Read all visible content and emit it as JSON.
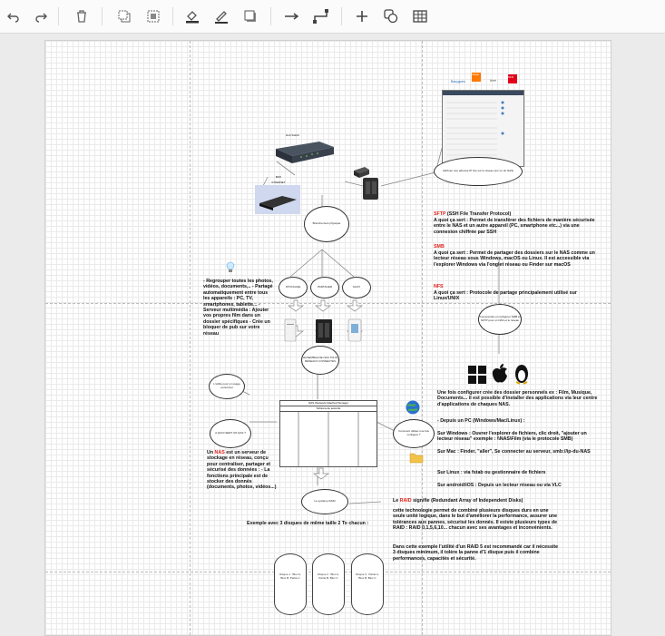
{
  "toolbar": {
    "icons": [
      "undo-icon",
      "redo-icon",
      "delete-icon",
      "to-front-icon",
      "to-back-icon",
      "fill-color-icon",
      "line-color-icon",
      "shadow-icon",
      "connection-icon",
      "waypoints-icon",
      "insert-icon",
      "shape-icon",
      "table-icon"
    ]
  },
  "diagram": {
    "isp_logos": [
      "Bouygues",
      "orange",
      "free",
      "SFR"
    ],
    "switch_label": "Hub Switch",
    "box_label": "BOX INTERNET",
    "ip_ellipse": "Attribuer une adresse IP fixe sur le réseau (sur un du NAS)",
    "montage_ellipse": "Branchement physique",
    "share_ellipses": [
      "STOCKAGE",
      "PARTAGER",
      "SAUV"
    ],
    "nas_ellipse": "ENSEMBLE DE NAS TOUS RESEAUX CONNECTES",
    "os_ellipse": "Comprendre et configurer SMB et SFTP pour un NAS et le réseau",
    "util_ellipse": "L'utilité pour un usage personnel",
    "what_ellipse": "A QUOI SERT UN NAS ?",
    "access_ellipse": "Comment utiliser une fois configuré ?",
    "raid_ellipse": "Le système RAID",
    "table_title": "NAS (Network Attached Storage)",
    "table_sub": "Schéma de sécurité",
    "sftp_title": "SFTP",
    "sftp_title_rest": " (SSH File Transfer Protocol)",
    "sftp_body": "A quoi ça sert : Permet de transférer des fichiers de manière sécurisée entre le NAS et un autre appareil (PC, smartphone etc...) via une connexion chiffrée par SSH",
    "smb_title": "SMB",
    "smb_body": "A quoi ça sert : Permet de partager des dossiers sur le NAS comme un lecteur réseau sous Windows, macOS ou Linux. Il est accessible via l'explorer Windows via l'onglet réseau ou Finder sur macOS",
    "nfs_title": "NFS",
    "nfs_body": "A quoi ça sert : Protocole de partage principalement utilisé sur Linux/UNIX",
    "left_list": "- Regrouper toutes les photos, vidéos, documents,.. - Partagé automatiquement entre tous les appareils : PC, TV, smartphones, tablette... - Serveur multimédia : Ajouter vos propres film dans un dossier spécifiques - Crée un bloquer de pub sur votre réseau",
    "nas_def_pre": "Un ",
    "nas_def_word": "NAS",
    "nas_def_rest": " est un serveur de stockage en réseau, conçu pour centraliser, partager et sécurisé des données : - La fonctions principale est de stocker des donnés (documents, photos, vidéos...)",
    "access_intro": "Une fois configurer crée des dossier personnels ex : Film, Musique, Documents... il est possible d'installer des applications via leur centre d'applications de chaques NAS.",
    "access_pc": "- Depuis un PC (Windows/Mac/Linux) :",
    "access_win": "Sur Windows : Ouvrer l'explorer de fichiers, clic droit, \"ajouter un lecteur réseau\" exemple : \\\\NAS\\Film (via le protocole SMB)",
    "access_mac": "Sur Mac : Finder, \"aller\", Se connecter au serveur, smb://ip-du-NAS",
    "access_linux": "Sur Linux : via fstab ou gestionnaire de fichiers",
    "access_mobile": "Sur android/iOS : Depuis un lecteur réseau ou via VLC",
    "raid_pre": "Le ",
    "raid_word": "RAID",
    "raid_rest": " signifie (Redundant Array of Independent Disks)",
    "raid_body": "cette technologie permet de combiné plusieurs disques durs en une seule unité logique, dans le but d'améliorer la performance, assurer une tolérances aux pannes, sécurisé les donnés. Il existe plusieurs types de RAID : RAID 0,1,5,6,10... chacun avec ses avantages et inconvénients.",
    "raid5_body": "Dans cette exemple l'utilité d'un RAID 5 est recommandé car il nécessite 3 disques minimum, il tolère la panne d'1 disque puis il combine performances, capacités et sécurité.",
    "example_label": "Exemple avec 3 disques de même taille 2 To chacun :",
    "disks": [
      "Disque 1 : Bloc A, Bloc B, Parité C",
      "Disque 2 : Bloc A, Parité B, Bloc C",
      "Disque 3 : Parité A, Bloc B, Bloc C"
    ]
  },
  "colors": {
    "accent_red": "#e0201a",
    "grid": "#eaeaea"
  }
}
